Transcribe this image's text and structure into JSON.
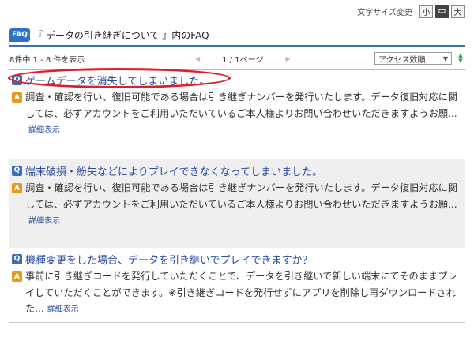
{
  "font_size": {
    "label": "文字サイズ変更",
    "options": [
      "小",
      "中",
      "大"
    ],
    "selected": "中"
  },
  "header": {
    "icon_text": "FAQ",
    "title": "『 データの引き継ぎについて 』内のFAQ"
  },
  "pager": {
    "count_text": "8件中 1 - 8 件を表示",
    "prev": "◀",
    "page_text": "1 / 1ページ",
    "next": "▶",
    "sort_value": "アクセス数順",
    "sort_caret": "▼",
    "sort_up": "▲",
    "sort_down": "▼"
  },
  "faq_items": [
    {
      "q_icon": "Q",
      "question": "ゲームデータを消失してしまいました。",
      "a_icon": "A",
      "answer": "調査・確認を行い、復旧可能である場合は引き継ぎナンバーを発行いたします。データ復旧対応に関しては、必ずアカウントをご利用いただいているご本人様よりお問い合わせいただきますようお願...",
      "detail_label": "詳細表示"
    },
    {
      "q_icon": "Q",
      "question": "端末破損・紛失などによりプレイできなくなってしまいました。",
      "a_icon": "A",
      "answer": "調査・確認を行い、復旧可能である場合は引き継ぎナンバーを発行いたします。データ復旧対応に関しては、必ずアカウントをご利用いただいているご本人様よりお問い合わせいただきますようお願...",
      "detail_label": "詳細表示"
    },
    {
      "q_icon": "Q",
      "question": "機種変更をした場合、データを引き継いでプレイできますか？",
      "a_icon": "A",
      "answer": "事前に引き継ぎコードを発行していただくことで、データを引き継いで新しい端末にてそのままプレイしていただくことができます。※引き継ぎコードを発行せずにアプリを削除し再ダウンロードされた...",
      "detail_label": "詳細表示"
    }
  ],
  "colors": {
    "accent": "#3a6fb0",
    "question_text": "#2b4c9c",
    "answer_icon": "#e59a1c",
    "highlight": "#e11d2a",
    "shaded_row": "#efefef"
  }
}
